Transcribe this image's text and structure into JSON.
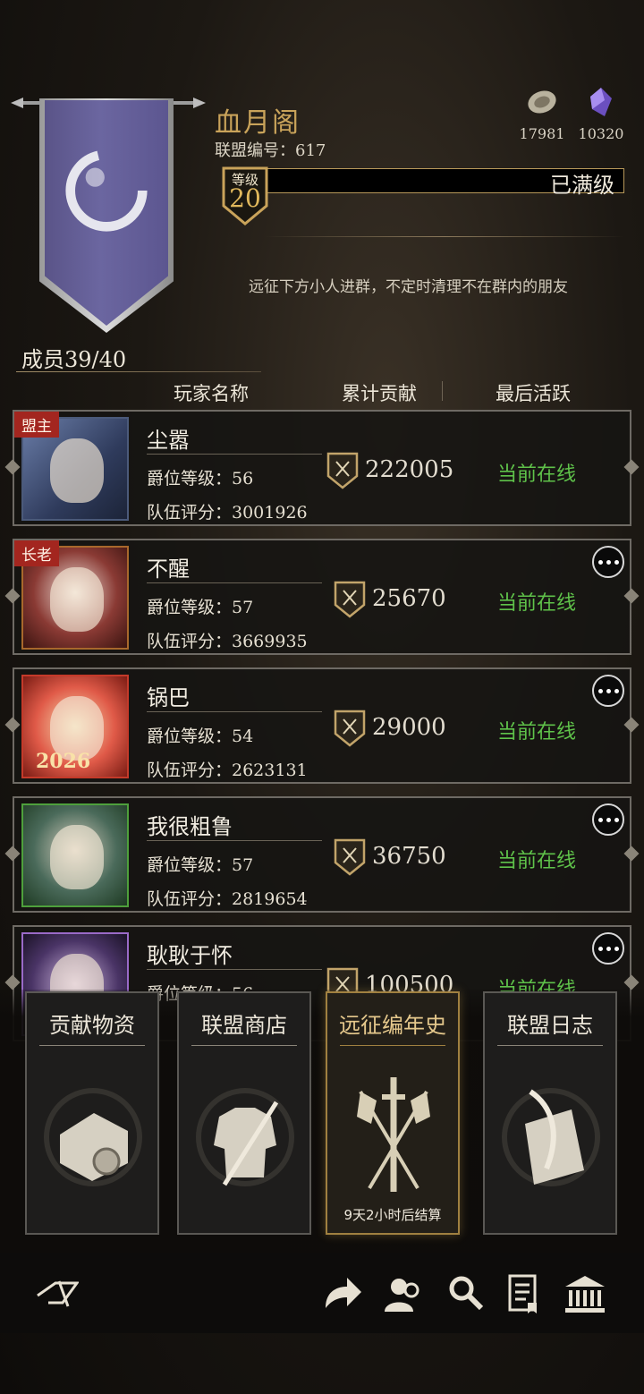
{
  "alliance": {
    "name": "血月阁",
    "id_text": "联盟编号：617",
    "level_label": "等级",
    "level": "20",
    "level_status": "已满级",
    "notice": "远征下方小人进群，不定时清理不在群内的朋友",
    "members_count": "成员39/40"
  },
  "resources": [
    {
      "icon": "coin-icon",
      "value": "17981"
    },
    {
      "icon": "crystal-icon",
      "value": "10320"
    }
  ],
  "table_headers": {
    "name": "玩家名称",
    "contribution": "累计贡献",
    "last_active": "最后活跃"
  },
  "members": [
    {
      "role": "盟主",
      "name": "尘嚣",
      "rank": "爵位等级：56",
      "score": "队伍评分：3001926",
      "contribution": "222005",
      "status": "当前在线"
    },
    {
      "role": "长老",
      "name": "不醒",
      "rank": "爵位等级：57",
      "score": "队伍评分：3669935",
      "contribution": "25670",
      "status": "当前在线"
    },
    {
      "role": "",
      "frame_text": "2026",
      "name": "锅巴",
      "rank": "爵位等级：54",
      "score": "队伍评分：2623131",
      "contribution": "29000",
      "status": "当前在线"
    },
    {
      "role": "",
      "name": "我很粗鲁",
      "rank": "爵位等级：57",
      "score": "队伍评分：2819654",
      "contribution": "36750",
      "status": "当前在线"
    },
    {
      "role": "",
      "name": "耿耿于怀",
      "rank": "爵位等级：56",
      "score": "",
      "contribution": "100500",
      "status": "当前在线"
    }
  ],
  "cards": [
    {
      "title": "贡献物资",
      "icon": "scroll-map-icon",
      "subtitle": ""
    },
    {
      "title": "联盟商店",
      "icon": "armor-sword-icon",
      "subtitle": ""
    },
    {
      "title": "远征编年史",
      "icon": "crossed-banners-sword-icon",
      "subtitle": "9天2小时后结算"
    },
    {
      "title": "联盟日志",
      "icon": "quill-parchment-icon",
      "subtitle": ""
    }
  ],
  "nav_icons": [
    "back-emblem-icon",
    "share-arrow-icon",
    "members-icon",
    "search-icon",
    "document-icon",
    "bank-icon"
  ]
}
